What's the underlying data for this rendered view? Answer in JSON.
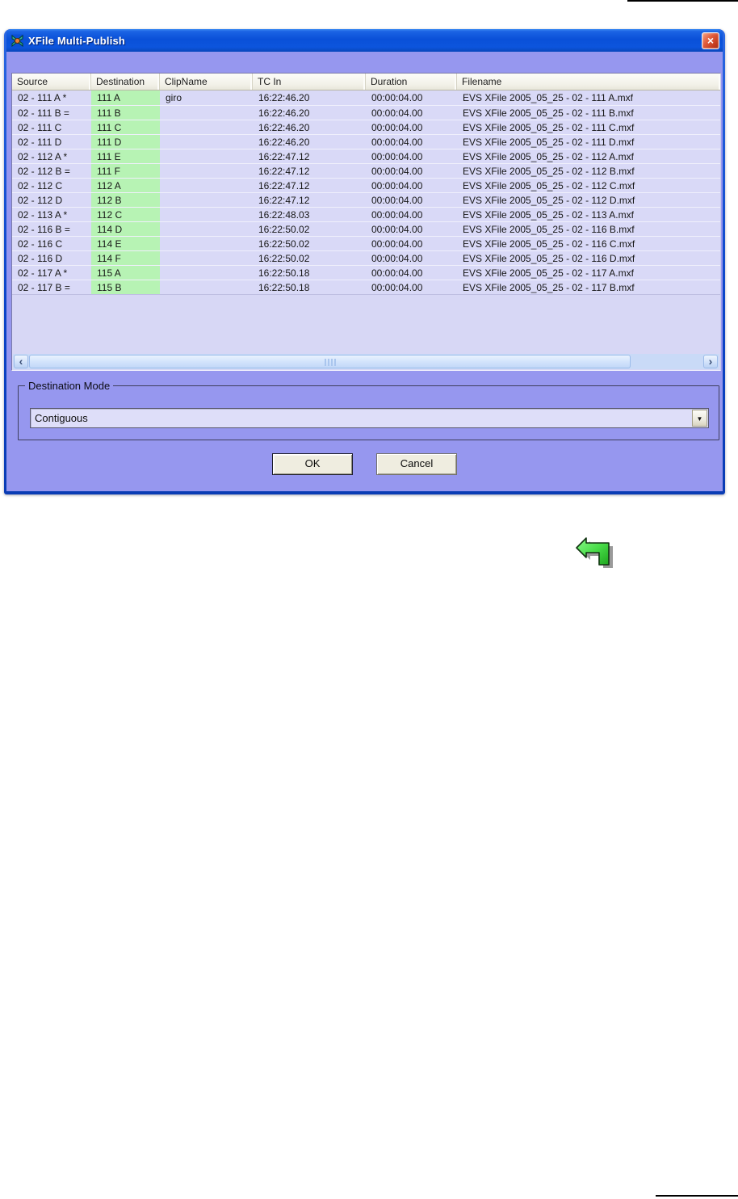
{
  "window": {
    "title": "XFile Multi-Publish",
    "close_glyph": "×"
  },
  "table": {
    "columns": [
      "Source",
      "Destination",
      "ClipName",
      "TC In",
      "Duration",
      "Filename"
    ],
    "rows": [
      {
        "source": "02 - 111 A *",
        "destination": "111 A",
        "clipname": "giro",
        "tcin": "16:22:46.20",
        "duration": "00:00:04.00",
        "filename": "EVS XFile 2005_05_25 - 02 - 111 A.mxf"
      },
      {
        "source": "02 - 111 B =",
        "destination": "111 B",
        "clipname": "",
        "tcin": "16:22:46.20",
        "duration": "00:00:04.00",
        "filename": "EVS XFile 2005_05_25 - 02 - 111 B.mxf"
      },
      {
        "source": "02 - 111 C",
        "destination": "111 C",
        "clipname": "",
        "tcin": "16:22:46.20",
        "duration": "00:00:04.00",
        "filename": "EVS XFile 2005_05_25 - 02 - 111 C.mxf"
      },
      {
        "source": "02 - 111 D",
        "destination": "111 D",
        "clipname": "",
        "tcin": "16:22:46.20",
        "duration": "00:00:04.00",
        "filename": "EVS XFile 2005_05_25 - 02 - 111 D.mxf"
      },
      {
        "source": "02 - 112 A *",
        "destination": "111 E",
        "clipname": "",
        "tcin": "16:22:47.12",
        "duration": "00:00:04.00",
        "filename": "EVS XFile 2005_05_25 - 02 - 112 A.mxf"
      },
      {
        "source": "02 - 112 B =",
        "destination": "111 F",
        "clipname": "",
        "tcin": "16:22:47.12",
        "duration": "00:00:04.00",
        "filename": "EVS XFile 2005_05_25 - 02 - 112 B.mxf"
      },
      {
        "source": "02 - 112 C",
        "destination": "112 A",
        "clipname": "",
        "tcin": "16:22:47.12",
        "duration": "00:00:04.00",
        "filename": "EVS XFile 2005_05_25 - 02 - 112 C.mxf"
      },
      {
        "source": "02 - 112 D",
        "destination": "112 B",
        "clipname": "",
        "tcin": "16:22:47.12",
        "duration": "00:00:04.00",
        "filename": "EVS XFile 2005_05_25 - 02 - 112 D.mxf"
      },
      {
        "source": "02 - 113 A *",
        "destination": "112 C",
        "clipname": "",
        "tcin": "16:22:48.03",
        "duration": "00:00:04.00",
        "filename": "EVS XFile 2005_05_25 - 02 - 113 A.mxf"
      },
      {
        "source": "02 - 116 B =",
        "destination": "114 D",
        "clipname": "",
        "tcin": "16:22:50.02",
        "duration": "00:00:04.00",
        "filename": "EVS XFile 2005_05_25 - 02 - 116 B.mxf"
      },
      {
        "source": "02 - 116 C",
        "destination": "114 E",
        "clipname": "",
        "tcin": "16:22:50.02",
        "duration": "00:00:04.00",
        "filename": "EVS XFile 2005_05_25 - 02 - 116 C.mxf"
      },
      {
        "source": "02 - 116 D",
        "destination": "114 F",
        "clipname": "",
        "tcin": "16:22:50.02",
        "duration": "00:00:04.00",
        "filename": "EVS XFile 2005_05_25 - 02 - 116 D.mxf"
      },
      {
        "source": "02 - 117 A *",
        "destination": "115 A",
        "clipname": "",
        "tcin": "16:22:50.18",
        "duration": "00:00:04.00",
        "filename": "EVS XFile 2005_05_25 - 02 - 117 A.mxf"
      },
      {
        "source": "02 - 117 B =",
        "destination": "115 B",
        "clipname": "",
        "tcin": "16:22:50.18",
        "duration": "00:00:04.00",
        "filename": "EVS XFile 2005_05_25 - 02 - 117 B.mxf"
      }
    ]
  },
  "scrollbar": {
    "left_glyph": "‹",
    "right_glyph": "›"
  },
  "destination_mode": {
    "label": "Destination Mode",
    "value": "Contiguous",
    "dropdown_glyph": "▼"
  },
  "actions": {
    "ok": "OK",
    "cancel": "Cancel"
  },
  "colors": {
    "client_bg": "#9697ef",
    "row_bg": "#d9d9f7",
    "destination_cell_bg": "#b7f3b4",
    "titlebar_blue": "#0a50d8",
    "close_red": "#c33c1e",
    "scroll_track": "#c9daf7",
    "header_bg": "#f2f1e8"
  }
}
